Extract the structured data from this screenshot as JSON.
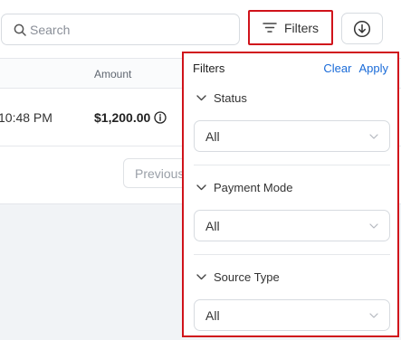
{
  "toolbar": {
    "search_placeholder": "Search",
    "filters_label": "Filters"
  },
  "table": {
    "amount_header": "Amount",
    "rows": [
      {
        "time": "10:48 PM",
        "amount": "$1,200.00"
      }
    ]
  },
  "pagination": {
    "previous_label": "Previous"
  },
  "filter_panel": {
    "title": "Filters",
    "clear_label": "Clear",
    "apply_label": "Apply",
    "sections": [
      {
        "label": "Status",
        "value": "All"
      },
      {
        "label": "Payment Mode",
        "value": "All"
      },
      {
        "label": "Source Type",
        "value": "All"
      }
    ]
  },
  "colors": {
    "accent_link": "#1a6bd8",
    "highlight_border": "#d0131b"
  }
}
